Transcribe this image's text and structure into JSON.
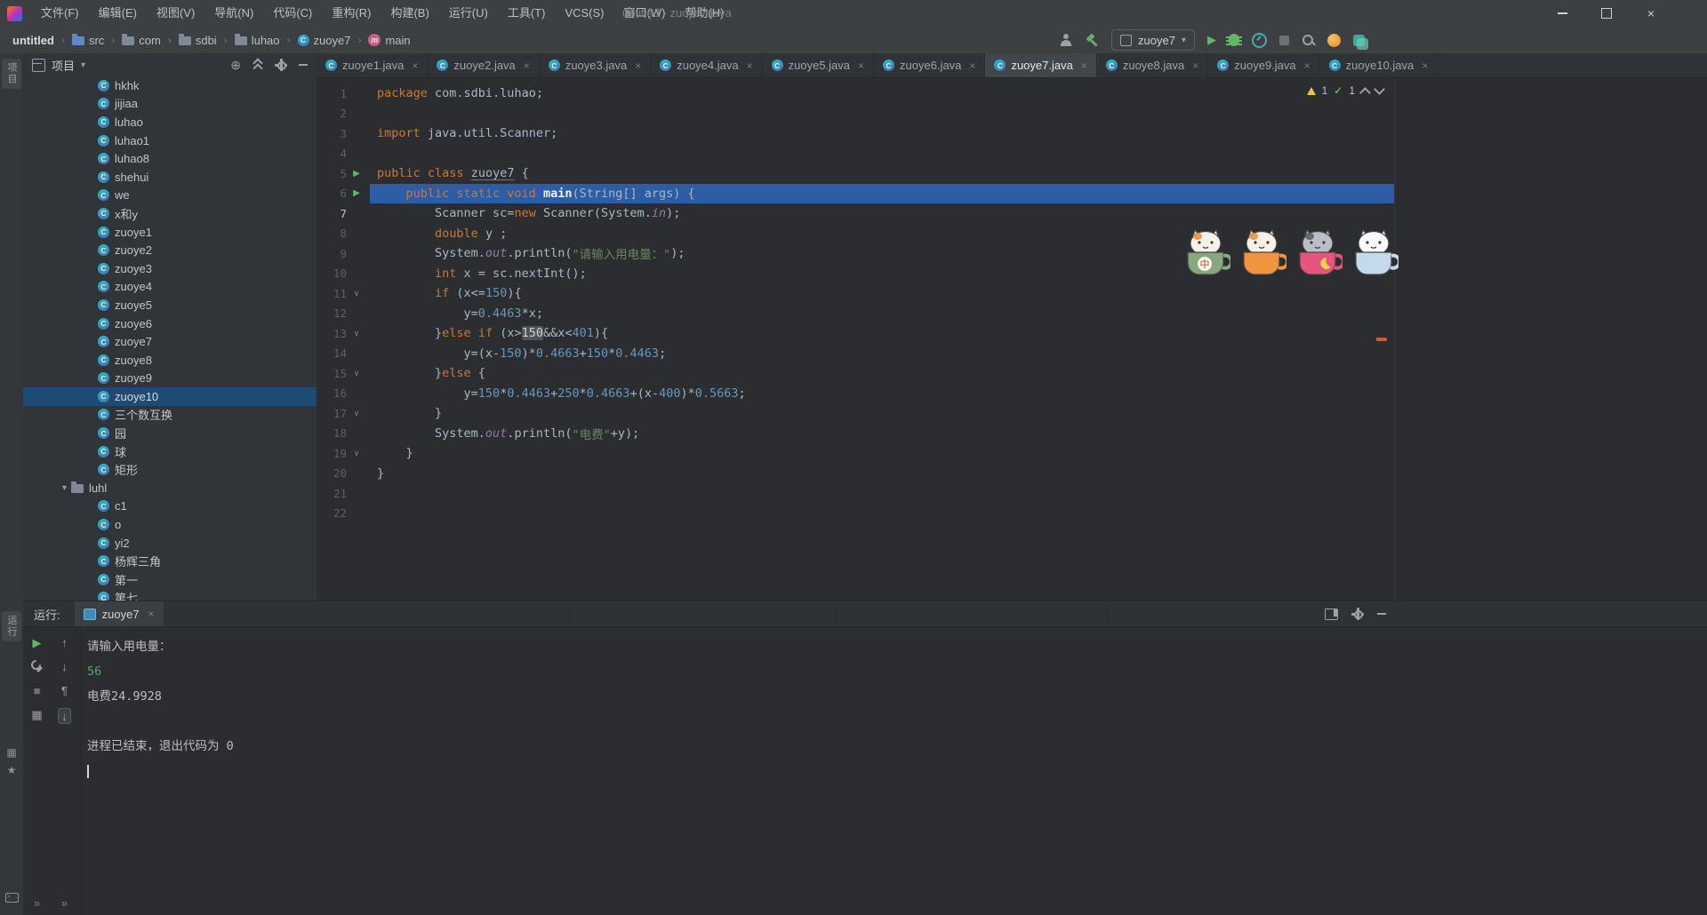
{
  "colors": {
    "titlebar": "#3c4043",
    "panel": "#313539",
    "editor_bg": "#2b2d30",
    "selection_line": "#2e5ca5",
    "tree_selection": "#1f4a73",
    "keyword_orange": "#cc7832",
    "string_green": "#6a8759",
    "number_blue": "#6897bb",
    "field_purple": "#9876aa",
    "run_green": "#5fb865",
    "warning_yellow": "#e8c252",
    "console_input_green": "#58a55c",
    "error_stripe_orange": "#cf5b2e"
  },
  "window": {
    "title": "untitled - zuoye7.java",
    "menus": [
      "文件(F)",
      "编辑(E)",
      "视图(V)",
      "导航(N)",
      "代码(C)",
      "重构(R)",
      "构建(B)",
      "运行(U)",
      "工具(T)",
      "VCS(S)",
      "窗口(W)",
      "帮助(H)"
    ]
  },
  "navbar": {
    "breadcrumbs": [
      {
        "label": "untitled",
        "icon": ""
      },
      {
        "label": "src",
        "icon": "folder-blue"
      },
      {
        "label": "com",
        "icon": "folder"
      },
      {
        "label": "sdbi",
        "icon": "folder"
      },
      {
        "label": "luhao",
        "icon": "folder"
      },
      {
        "label": "zuoye7",
        "icon": "class"
      },
      {
        "label": "main",
        "icon": "method"
      }
    ],
    "run_config": "zuoye7"
  },
  "stripe": {
    "project_label": "项目",
    "run_label": "运行"
  },
  "project": {
    "header_title": "项目",
    "rows": [
      {
        "label": "hkhk",
        "type": "class"
      },
      {
        "label": "jijiaa",
        "type": "class"
      },
      {
        "label": "luhao",
        "type": "class"
      },
      {
        "label": "luhao1",
        "type": "class"
      },
      {
        "label": "luhao8",
        "type": "class"
      },
      {
        "label": "shehui",
        "type": "class"
      },
      {
        "label": "we",
        "type": "class"
      },
      {
        "label": "x和y",
        "type": "class"
      },
      {
        "label": "zuoye1",
        "type": "class"
      },
      {
        "label": "zuoye2",
        "type": "class"
      },
      {
        "label": "zuoye3",
        "type": "class"
      },
      {
        "label": "zuoye4",
        "type": "class"
      },
      {
        "label": "zuoye5",
        "type": "class"
      },
      {
        "label": "zuoye6",
        "type": "class"
      },
      {
        "label": "zuoye7",
        "type": "class"
      },
      {
        "label": "zuoye8",
        "type": "class"
      },
      {
        "label": "zuoye9",
        "type": "class"
      },
      {
        "label": "zuoye10",
        "type": "class",
        "selected": true
      },
      {
        "label": "三个数互换",
        "type": "class"
      },
      {
        "label": "园",
        "type": "class"
      },
      {
        "label": "球",
        "type": "class"
      },
      {
        "label": "矩形",
        "type": "class"
      },
      {
        "label": "luhl",
        "type": "folder"
      },
      {
        "label": "c1",
        "type": "class"
      },
      {
        "label": "o",
        "type": "class"
      },
      {
        "label": "yi2",
        "type": "class"
      },
      {
        "label": "杨辉三角",
        "type": "class"
      },
      {
        "label": "第一",
        "type": "class"
      },
      {
        "label": "第七",
        "type": "class"
      }
    ]
  },
  "tabs": {
    "active": "zuoye7.java",
    "items": [
      {
        "label": "zuoye1.java"
      },
      {
        "label": "zuoye2.java"
      },
      {
        "label": "zuoye3.java"
      },
      {
        "label": "zuoye4.java"
      },
      {
        "label": "zuoye5.java"
      },
      {
        "label": "zuoye6.java"
      },
      {
        "label": "zuoye7.java"
      },
      {
        "label": "zuoye8.java"
      },
      {
        "label": "zuoye9.java"
      },
      {
        "label": "zuoye10.java"
      }
    ]
  },
  "editor": {
    "inspections": {
      "warnings": "1",
      "passed": "1"
    },
    "lines": [
      {
        "n": 1,
        "seg": [
          [
            "k",
            "package"
          ],
          [
            "d",
            " com.sdbi.luhao;"
          ]
        ]
      },
      {
        "n": 2,
        "seg": []
      },
      {
        "n": 3,
        "seg": [
          [
            "k",
            "import"
          ],
          [
            "d",
            " java.util.Scanner;"
          ]
        ]
      },
      {
        "n": 4,
        "seg": []
      },
      {
        "n": 5,
        "run": true,
        "seg": [
          [
            "k",
            "public class"
          ],
          [
            "d",
            " "
          ],
          [
            "u",
            "zuoye7"
          ],
          [
            "d",
            " {"
          ]
        ]
      },
      {
        "n": 6,
        "run": true,
        "hl": true,
        "seg": [
          [
            "d",
            "    "
          ],
          [
            "k",
            "public static void"
          ],
          [
            "d",
            " "
          ],
          [
            "m",
            "main"
          ],
          [
            "d",
            "(String[] args) {"
          ]
        ]
      },
      {
        "n": 7,
        "cur": true,
        "seg": [
          [
            "d",
            "        Scanner sc="
          ],
          [
            "k",
            "new"
          ],
          [
            "d",
            " Scanner(System."
          ],
          [
            "f",
            "in"
          ],
          [
            "d",
            ");"
          ]
        ]
      },
      {
        "n": 8,
        "seg": [
          [
            "d",
            "        "
          ],
          [
            "k",
            "double"
          ],
          [
            "d",
            " y ;"
          ]
        ]
      },
      {
        "n": 9,
        "seg": [
          [
            "d",
            "        System."
          ],
          [
            "f",
            "out"
          ],
          [
            "d",
            ".println("
          ],
          [
            "s",
            "\"请输入用电量：\""
          ],
          [
            "d",
            ");"
          ]
        ]
      },
      {
        "n": 10,
        "seg": [
          [
            "d",
            "        "
          ],
          [
            "k",
            "int"
          ],
          [
            "d",
            " x = sc.nextInt();"
          ]
        ]
      },
      {
        "n": 11,
        "fold": true,
        "seg": [
          [
            "d",
            "        "
          ],
          [
            "k",
            "if"
          ],
          [
            "d",
            " (x<="
          ],
          [
            "n",
            "150"
          ],
          [
            "d",
            "){"
          ]
        ]
      },
      {
        "n": 12,
        "seg": [
          [
            "d",
            "            y="
          ],
          [
            "n",
            "0.4463"
          ],
          [
            "d",
            "*x;"
          ]
        ]
      },
      {
        "n": 13,
        "fold": true,
        "seg": [
          [
            "d",
            "        }"
          ],
          [
            "k",
            "else"
          ],
          [
            "d",
            " "
          ],
          [
            "k",
            "if"
          ],
          [
            "d",
            " (x>"
          ],
          [
            "hn",
            "150"
          ],
          [
            "d",
            "&&x<"
          ],
          [
            "n",
            "401"
          ],
          [
            "d",
            "){"
          ]
        ]
      },
      {
        "n": 14,
        "seg": [
          [
            "d",
            "            y=(x-"
          ],
          [
            "n",
            "150"
          ],
          [
            "d",
            ")*"
          ],
          [
            "n",
            "0.4663"
          ],
          [
            "d",
            "+"
          ],
          [
            "n",
            "150"
          ],
          [
            "d",
            "*"
          ],
          [
            "n",
            "0.4463"
          ],
          [
            "d",
            ";"
          ]
        ]
      },
      {
        "n": 15,
        "fold": true,
        "seg": [
          [
            "d",
            "        }"
          ],
          [
            "k",
            "else"
          ],
          [
            "d",
            " {"
          ]
        ]
      },
      {
        "n": 16,
        "seg": [
          [
            "d",
            "            y="
          ],
          [
            "n",
            "150"
          ],
          [
            "d",
            "*"
          ],
          [
            "n",
            "0.4463"
          ],
          [
            "d",
            "+"
          ],
          [
            "n",
            "250"
          ],
          [
            "d",
            "*"
          ],
          [
            "n",
            "0.4663"
          ],
          [
            "d",
            "+(x-"
          ],
          [
            "n",
            "400"
          ],
          [
            "d",
            ")*"
          ],
          [
            "n",
            "0.5663"
          ],
          [
            "d",
            ";"
          ]
        ]
      },
      {
        "n": 17,
        "fold": true,
        "seg": [
          [
            "d",
            "        }"
          ]
        ]
      },
      {
        "n": 18,
        "seg": [
          [
            "d",
            "        System."
          ],
          [
            "f",
            "out"
          ],
          [
            "d",
            ".println("
          ],
          [
            "s",
            "\"电费\""
          ],
          [
            "d",
            "+y);"
          ]
        ]
      },
      {
        "n": 19,
        "fold": true,
        "seg": [
          [
            "d",
            "    }"
          ]
        ]
      },
      {
        "n": 20,
        "seg": [
          [
            "d",
            "}"
          ]
        ]
      },
      {
        "n": 21,
        "seg": []
      },
      {
        "n": 22,
        "seg": []
      }
    ]
  },
  "stickers": [
    {
      "name": "cat-in-green-cup",
      "cup": "#87a77f",
      "cat": "#f5f0e8",
      "patch": "#e8923c",
      "badge": "中"
    },
    {
      "name": "cat-in-orange-cup",
      "cup": "#ef9440",
      "cat": "#f5f0e8",
      "patch": "#e8923c"
    },
    {
      "name": "cat-in-pink-cup",
      "cup": "#e4547e",
      "cat": "#b9bec7",
      "patch": "#5a5f68",
      "moon": true
    },
    {
      "name": "cat-in-blue-cup",
      "cup": "#c3d9ec",
      "cat": "#f7f9fb"
    }
  ],
  "console": {
    "label": "运行:",
    "tab": "zuoye7",
    "lines": [
      {
        "text": "请输入用电量：",
        "type": "out"
      },
      {
        "text": "56",
        "type": "in"
      },
      {
        "text": "电费24.9928",
        "type": "out"
      },
      {
        "text": "",
        "type": "out"
      },
      {
        "text": "进程已结束，退出代码为 0",
        "type": "out"
      }
    ]
  }
}
